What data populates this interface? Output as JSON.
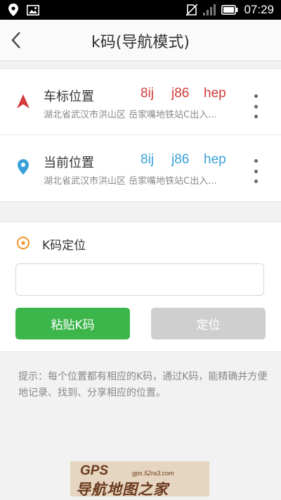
{
  "status_bar": {
    "time": "07:29"
  },
  "header": {
    "title": "k码(导航模式)"
  },
  "locations": [
    {
      "title": "车标位置",
      "code": [
        "8ij",
        "j86",
        "hep"
      ],
      "code_color": "#d13b3b",
      "address": "湖北省武汉市洪山区 岳家嘴地铁站C出入...",
      "icon": "car-marker-icon"
    },
    {
      "title": "当前位置",
      "code": [
        "8ij",
        "j86",
        "hep"
      ],
      "code_color": "#3aa0d8",
      "address": "湖北省武汉市洪山区 岳家嘴地铁站C出入...",
      "icon": "location-pin-icon"
    }
  ],
  "kcode_locate": {
    "title": "K码定位",
    "paste_label": "粘贴K码",
    "locate_label": "定位"
  },
  "hint": "提示：每个位置都有相应的K码，通过K码，能精确并方便地记录、找到、分享相应的位置。",
  "watermark": {
    "brand": "GPS",
    "url": "gps.52ra3.com",
    "name": "导航地图之家"
  },
  "colors": {
    "accent_green": "#3cb54a",
    "disabled_gray": "#cfcfcf",
    "orange_icon": "#f0922a"
  }
}
